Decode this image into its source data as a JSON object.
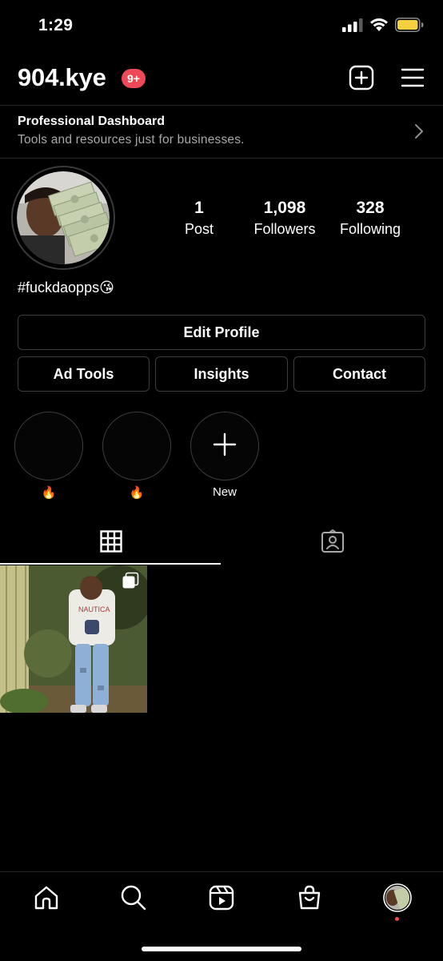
{
  "status_bar": {
    "time": "1:29",
    "icons": [
      "cellular-signal-icon",
      "wifi-icon",
      "battery-icon"
    ],
    "battery_color": "#f4d03f"
  },
  "header": {
    "username": "904.kye",
    "notification_badge": "9+",
    "badge_color": "#ed4956",
    "icons": [
      "new-post-icon",
      "menu-icon"
    ]
  },
  "professional_dashboard": {
    "title": "Professional Dashboard",
    "subtitle": "Tools and resources just for businesses."
  },
  "profile": {
    "stats": [
      {
        "count": "1",
        "label": "Post"
      },
      {
        "count": "1,098",
        "label": "Followers"
      },
      {
        "count": "328",
        "label": "Following"
      }
    ],
    "bio": "#fuckdaopps😘"
  },
  "buttons": {
    "edit_profile": "Edit Profile",
    "ad_tools": "Ad Tools",
    "insights": "Insights",
    "contact": "Contact"
  },
  "highlights": [
    {
      "label": "🔥"
    },
    {
      "label": "🔥"
    },
    {
      "label": "New"
    }
  ],
  "tabs": [
    {
      "name": "posts-grid",
      "icon": "grid-icon",
      "active": true
    },
    {
      "name": "tagged",
      "icon": "tagged-user-icon",
      "active": false
    }
  ],
  "posts": [
    {
      "type": "carousel",
      "icon": "multiple-posts-icon"
    }
  ],
  "bottom_nav": {
    "items": [
      "home-icon",
      "search-icon",
      "reels-icon",
      "shop-icon",
      "profile-avatar"
    ],
    "activity_dot_color": "#ed4956"
  }
}
